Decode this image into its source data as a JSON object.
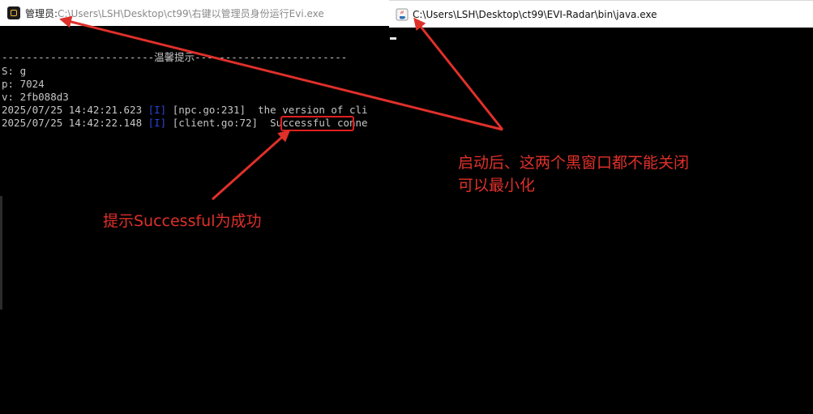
{
  "left_window": {
    "title_prefix": "管理员: ",
    "title_path": "C:\\Users\\LSH\\Desktop\\ct99\\右键以管理员身份运行Evi.exe",
    "icon": "app-icon",
    "console_lines": {
      "header": "-------------------------温馨提示-------------------------",
      "s": "S: g",
      "p": "p: 7024",
      "v": "v: 2fb088d3",
      "log1_time": "2025/07/25 14:42:21.623 ",
      "log1_level": "[I]",
      "log1_rest": " [npc.go:231]  the version of cli",
      "log2_time": "2025/07/25 14:42:22.148 ",
      "log2_level": "[I]",
      "log2_src": " [client.go:72] ",
      "log2_success": " Successful ",
      "log2_rest": "conne"
    }
  },
  "right_window": {
    "title": "C:\\Users\\LSH\\Desktop\\ct99\\EVI-Radar\\bin\\java.exe",
    "icon": "java-icon"
  },
  "annotations": {
    "left_note": "提示Successful为成功",
    "right_note_line1": "启动后、这两个黑窗口都不能关闭",
    "right_note_line2": "可以最小化",
    "color": "#e0302a"
  },
  "colors": {
    "console_text": "#c6c6c6",
    "console_blue": "#2d45d4",
    "annotation_red": "#e0302a"
  }
}
